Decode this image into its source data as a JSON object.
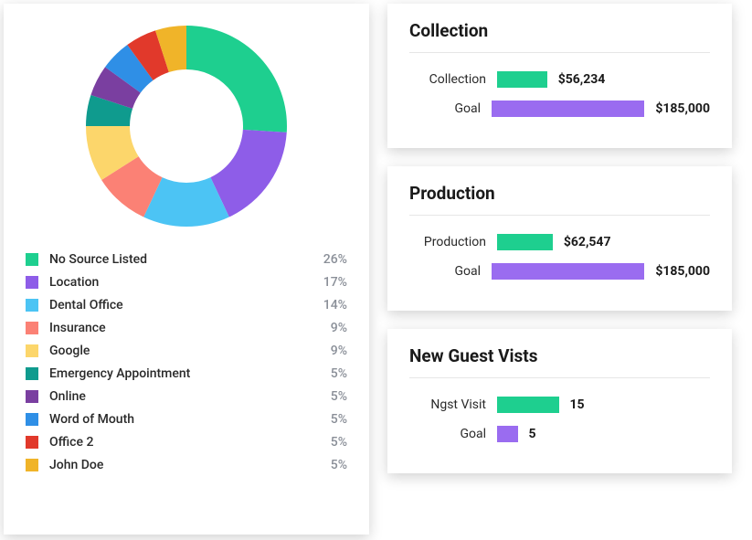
{
  "chart_data": {
    "type": "pie",
    "title": "",
    "series": [
      {
        "name": "No Source Listed",
        "value": 26,
        "color": "#1ecf8f"
      },
      {
        "name": "Location",
        "value": 17,
        "color": "#8e5de8"
      },
      {
        "name": "Dental Office",
        "value": 14,
        "color": "#4cc4f4"
      },
      {
        "name": "Insurance",
        "value": 9,
        "color": "#fb8175"
      },
      {
        "name": "Google",
        "value": 9,
        "color": "#fcd66b"
      },
      {
        "name": "Emergency Appointment",
        "value": 5,
        "color": "#0f9b8e"
      },
      {
        "name": "Online",
        "value": 5,
        "color": "#7a3fa0"
      },
      {
        "name": "Word of Mouth",
        "value": 5,
        "color": "#2f8fe6"
      },
      {
        "name": "Office 2",
        "value": 5,
        "color": "#e1392b"
      },
      {
        "name": "John Doe",
        "value": 5,
        "color": "#f0b429"
      }
    ]
  },
  "collection": {
    "title": "Collection",
    "rows": [
      {
        "label": "Collection",
        "value": "$56,234",
        "num": 56234,
        "color": "#1ecf8f"
      },
      {
        "label": "Goal",
        "value": "$185,000",
        "num": 185000,
        "color": "#9a6cf0"
      }
    ],
    "max": 185000,
    "full_width": 180
  },
  "production": {
    "title": "Production",
    "rows": [
      {
        "label": "Production",
        "value": "$62,547",
        "num": 62547,
        "color": "#1ecf8f"
      },
      {
        "label": "Goal",
        "value": "$185,000",
        "num": 185000,
        "color": "#9a6cf0"
      }
    ],
    "max": 185000,
    "full_width": 180
  },
  "visits": {
    "title": "New Guest Vists",
    "rows": [
      {
        "label": "Ngst Visit",
        "value": "15",
        "num": 15,
        "color": "#1ecf8f"
      },
      {
        "label": "Goal",
        "value": "5",
        "num": 5,
        "color": "#9a6cf0"
      }
    ],
    "max": 40,
    "full_width": 180
  }
}
